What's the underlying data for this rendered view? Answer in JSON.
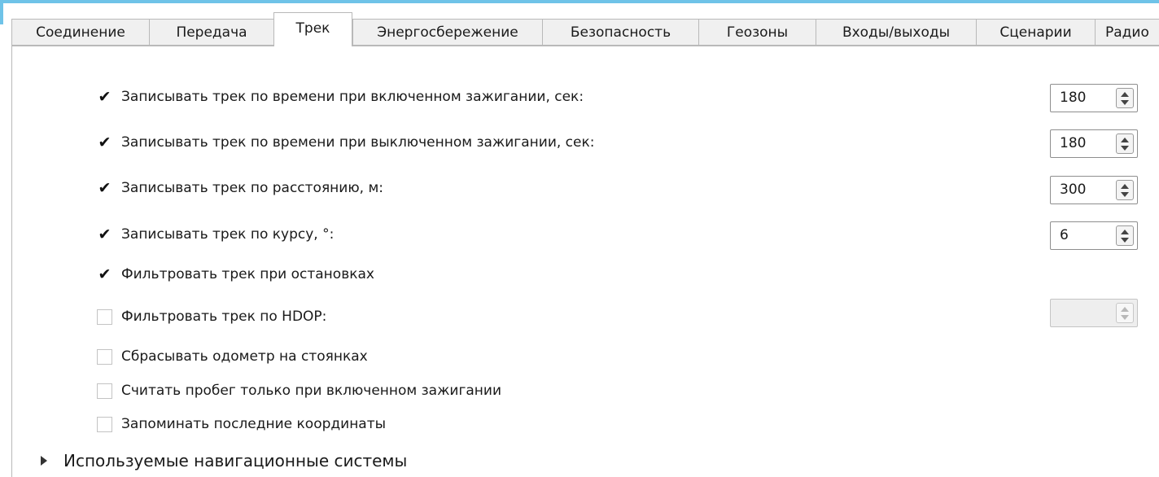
{
  "tabs": [
    {
      "label": "Соединение",
      "active": false
    },
    {
      "label": "Передача",
      "active": false
    },
    {
      "label": "Трек",
      "active": true
    },
    {
      "label": "Энергосбережение",
      "active": false
    },
    {
      "label": "Безопасность",
      "active": false
    },
    {
      "label": "Геозоны",
      "active": false
    },
    {
      "label": "Входы/выходы",
      "active": false
    },
    {
      "label": "Сценарии",
      "active": false
    },
    {
      "label": "Радио",
      "active": false
    }
  ],
  "options": [
    {
      "label": "Записывать трек по времени при включенном зажигании, сек:",
      "checked": true,
      "check_glyph": "✔",
      "value": "180",
      "enabled": true
    },
    {
      "label": "Записывать трек по времени при выключенном зажигании, сек:",
      "checked": true,
      "check_glyph": "✔",
      "value": "180",
      "enabled": true
    },
    {
      "label": "Записывать трек по расстоянию, м:",
      "checked": true,
      "check_glyph": "✔",
      "value": "300",
      "enabled": true
    },
    {
      "label": "Записывать трек по курсу, °:",
      "checked": true,
      "check_glyph": "✔",
      "value": "6",
      "enabled": true
    },
    {
      "label": "Фильтровать трек при остановках",
      "checked": true,
      "check_glyph": "✔"
    },
    {
      "label": "Фильтровать трек по HDOP:",
      "checked": false,
      "check_glyph": "",
      "value": "",
      "enabled": false
    },
    {
      "label": "Сбрасывать одометр на стоянках",
      "checked": false,
      "check_glyph": ""
    },
    {
      "label": "Считать пробег только при включенном зажигании",
      "checked": false,
      "check_glyph": ""
    },
    {
      "label": "Запоминать последние координаты",
      "checked": false,
      "check_glyph": ""
    }
  ],
  "section": {
    "label": "Используемые навигационные системы",
    "icon": "expand-triangle-icon",
    "expanded": false
  },
  "colors": {
    "accent_frame": "#6fc3e8",
    "tab_bg": "#f0f0f0",
    "border": "#b9b9b9"
  }
}
